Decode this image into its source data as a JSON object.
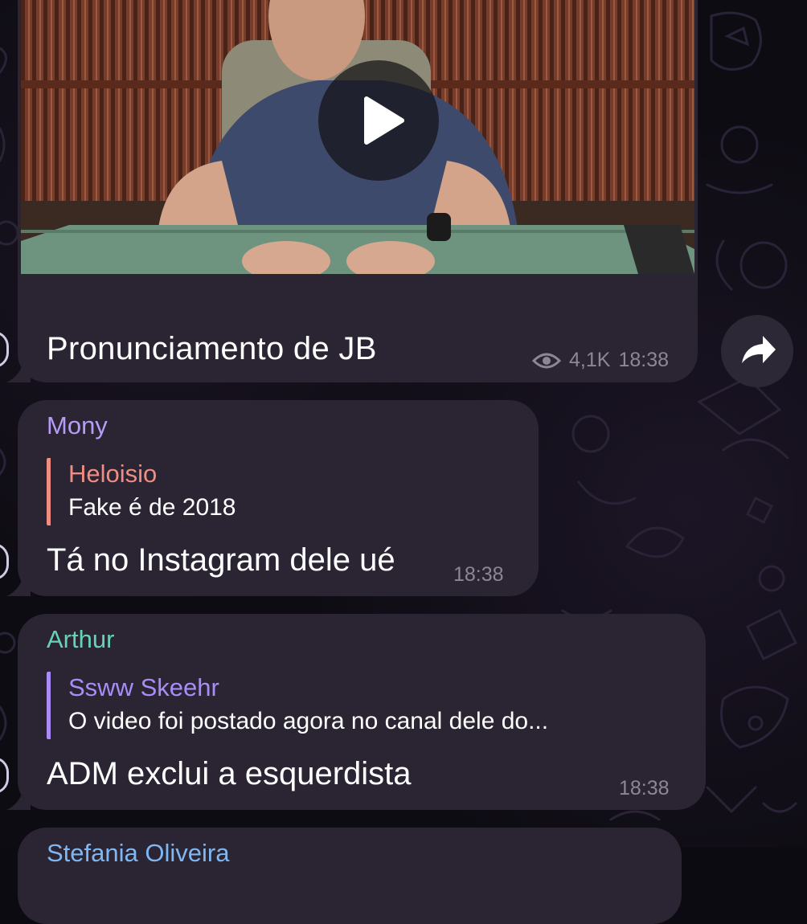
{
  "video_post": {
    "caption": "Pronunciamento de JB",
    "views": "4,1K",
    "time": "18:38"
  },
  "messages": [
    {
      "sender": "Mony",
      "sender_color": "#b79cf7",
      "reply_to": {
        "name": "Heloisio",
        "name_color": "#f08d83",
        "text": "Fake é de 2018"
      },
      "text": "Tá no Instagram dele ué",
      "time": "18:38"
    },
    {
      "sender": "Arthur",
      "sender_color": "#67d3b4",
      "reply_to": {
        "name": "Ssww Skeehr",
        "name_color": "#a98cf7",
        "text": "O video foi postado agora no canal dele do..."
      },
      "text": "ADM exclui a esquerdista",
      "time": "18:38"
    },
    {
      "sender": "Stefania Oliveira",
      "sender_color": "#7fb7f2"
    }
  ],
  "icons": {
    "play": "play-icon",
    "share": "share-arrow-icon",
    "views": "eye-icon"
  }
}
